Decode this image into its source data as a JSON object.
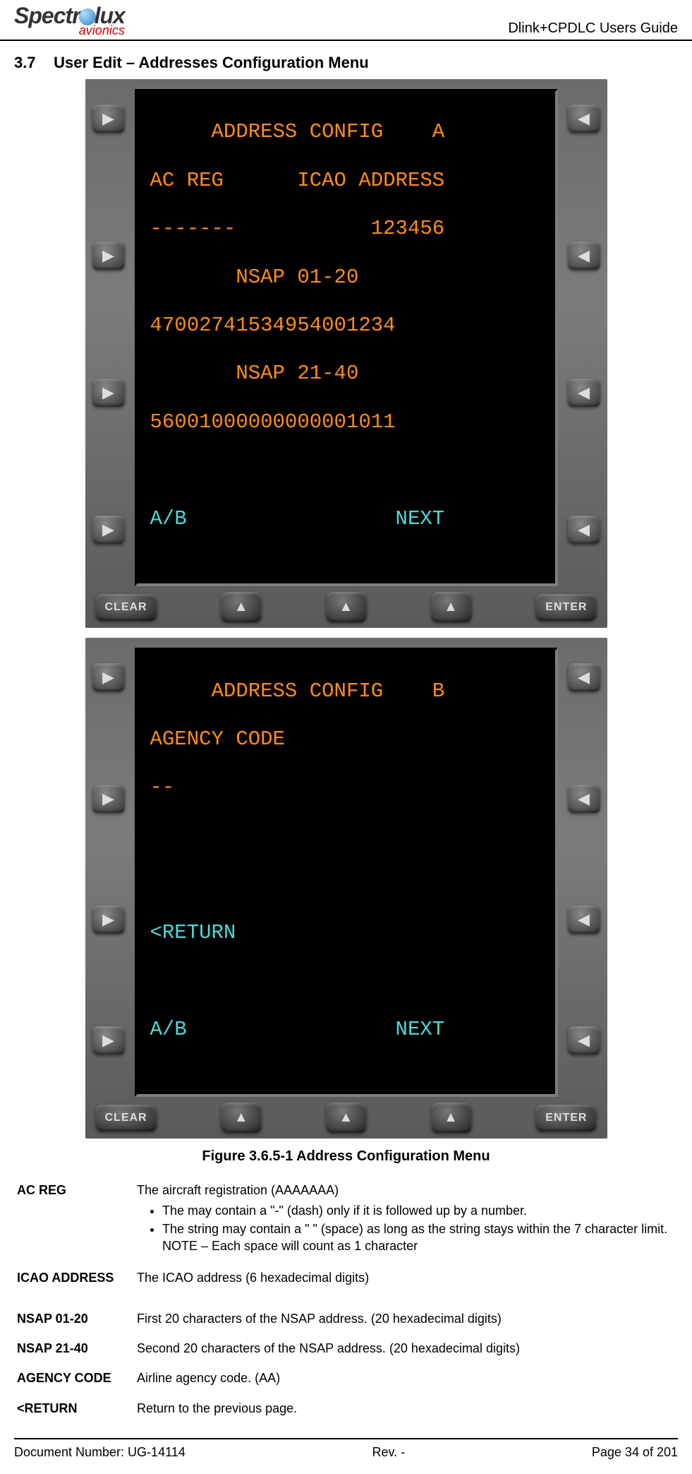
{
  "header": {
    "logo_top": "Spectralux",
    "logo_sub": "avionics",
    "title": "Dlink+CPDLC Users Guide"
  },
  "section": {
    "number": "3.7",
    "title": "User Edit – Addresses Configuration Menu"
  },
  "cdu_a": {
    "l1": "     ADDRESS CONFIG    A",
    "l2": "AC REG      ICAO ADDRESS",
    "l3": "-------           123456",
    "l4": "       NSAP 01-20",
    "l5": "47002741534954001234",
    "l6": "       NSAP 21-40",
    "l7": "56001000000000001011",
    "l8": "",
    "l9": "A/B                 NEXT",
    "bottom": {
      "clear": "CLEAR",
      "enter": "ENTER"
    }
  },
  "cdu_b": {
    "l1": "     ADDRESS CONFIG    B",
    "l2": "AGENCY CODE",
    "l3": "--",
    "l4": "",
    "l5": "",
    "l6": "<RETURN",
    "l7": "",
    "l8": "A/B                 NEXT",
    "bottom": {
      "clear": "CLEAR",
      "enter": "ENTER"
    }
  },
  "figure_caption": "Figure 3.6.5-1 Address Configuration Menu",
  "defs": {
    "ac_reg": {
      "term": "AC REG",
      "desc": "The aircraft registration (AAAAAAA)",
      "b1": "The may contain a \"-\" (dash) only if it is followed up by a number.",
      "b2": "The string may contain a \" \" (space) as long as the string stays within the 7 character limit. NOTE – Each space will count as 1 character"
    },
    "icao": {
      "term": "ICAO ADDRESS",
      "desc": "The ICAO address  (6 hexadecimal digits)"
    },
    "nsap1": {
      "term": "NSAP 01-20",
      "desc": "First 20 characters of the NSAP address. (20 hexadecimal digits)"
    },
    "nsap2": {
      "term": "NSAP 21-40",
      "desc": "Second 20 characters of the NSAP address. (20 hexadecimal digits)"
    },
    "agency": {
      "term": "AGENCY CODE",
      "desc": "Airline agency code. (AA)"
    },
    "return": {
      "term": "<RETURN",
      "desc": "Return to the previous page."
    }
  },
  "footer": {
    "doc": "Document Number:  UG-14114",
    "rev": "Rev. -",
    "page": "Page 34 of 201"
  }
}
